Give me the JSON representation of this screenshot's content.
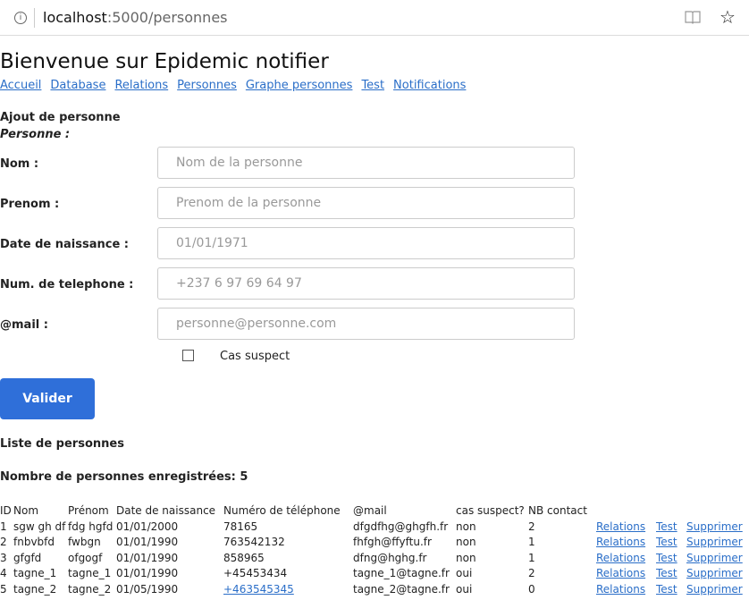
{
  "browser": {
    "url_host": "localhost",
    "url_path": ":5000/personnes",
    "info_glyph": "i",
    "book_icon": "reading-view-icon",
    "star_icon": "favorite-star-icon"
  },
  "page": {
    "title": "Bienvenue sur Epidemic notifier",
    "nav": [
      "Accueil",
      "Database",
      "Relations",
      "Personnes",
      "Graphe personnes",
      "Test",
      "Notifications"
    ]
  },
  "form": {
    "heading": "Ajout de personne",
    "subheading": "Personne :",
    "fields": [
      {
        "label": "Nom :",
        "placeholder": "Nom de la personne"
      },
      {
        "label": "Prenom :",
        "placeholder": "Prenom de la personne"
      },
      {
        "label": "Date de naissance :",
        "placeholder": "01/01/1971"
      },
      {
        "label": "Num. de telephone :",
        "placeholder": "+237 6 97 69 64 97"
      },
      {
        "label": "@mail :",
        "placeholder": "personne@personne.com"
      }
    ],
    "checkbox_label": "Cas suspect",
    "checkbox_checked": false,
    "submit_label": "Valider"
  },
  "list": {
    "heading": "Liste de personnes",
    "count_text": "Nombre de personnes enregistrées: 5",
    "columns": [
      "ID",
      "Nom",
      "Prénom",
      "Date de naissance",
      "Numéro de téléphone",
      "@mail",
      "cas suspect?",
      "NB contact"
    ],
    "rows": [
      {
        "id": "1",
        "nom": "sgw gh df",
        "prenom": "fdg hgfd",
        "date": "01/01/2000",
        "tel": "78165",
        "mail": "dfgdfhg@ghgfh.fr",
        "suspect": "non",
        "nb": "2"
      },
      {
        "id": "2",
        "nom": "fnbvbfd",
        "prenom": "fwbgn",
        "date": "01/01/1990",
        "tel": "763542132",
        "mail": "fhfgh@ffyftu.fr",
        "suspect": "non",
        "nb": "1"
      },
      {
        "id": "3",
        "nom": "gfgfd",
        "prenom": "ofgogf",
        "date": "01/01/1990",
        "tel": "858965",
        "mail": "dfng@hghg.fr",
        "suspect": "non",
        "nb": "1"
      },
      {
        "id": "4",
        "nom": "tagne_1",
        "prenom": "tagne_1",
        "date": "01/01/1990",
        "tel": "+45453434",
        "mail": "tagne_1@tagne.fr",
        "suspect": "oui",
        "nb": "2"
      },
      {
        "id": "5",
        "nom": "tagne_2",
        "prenom": "tagne_2",
        "date": "01/05/1990",
        "tel": "+463545345",
        "mail": "tagne_2@tagne.fr",
        "suspect": "oui",
        "nb": "0"
      }
    ],
    "row_actions": [
      "Relations",
      "Test",
      "Supprimer"
    ]
  }
}
